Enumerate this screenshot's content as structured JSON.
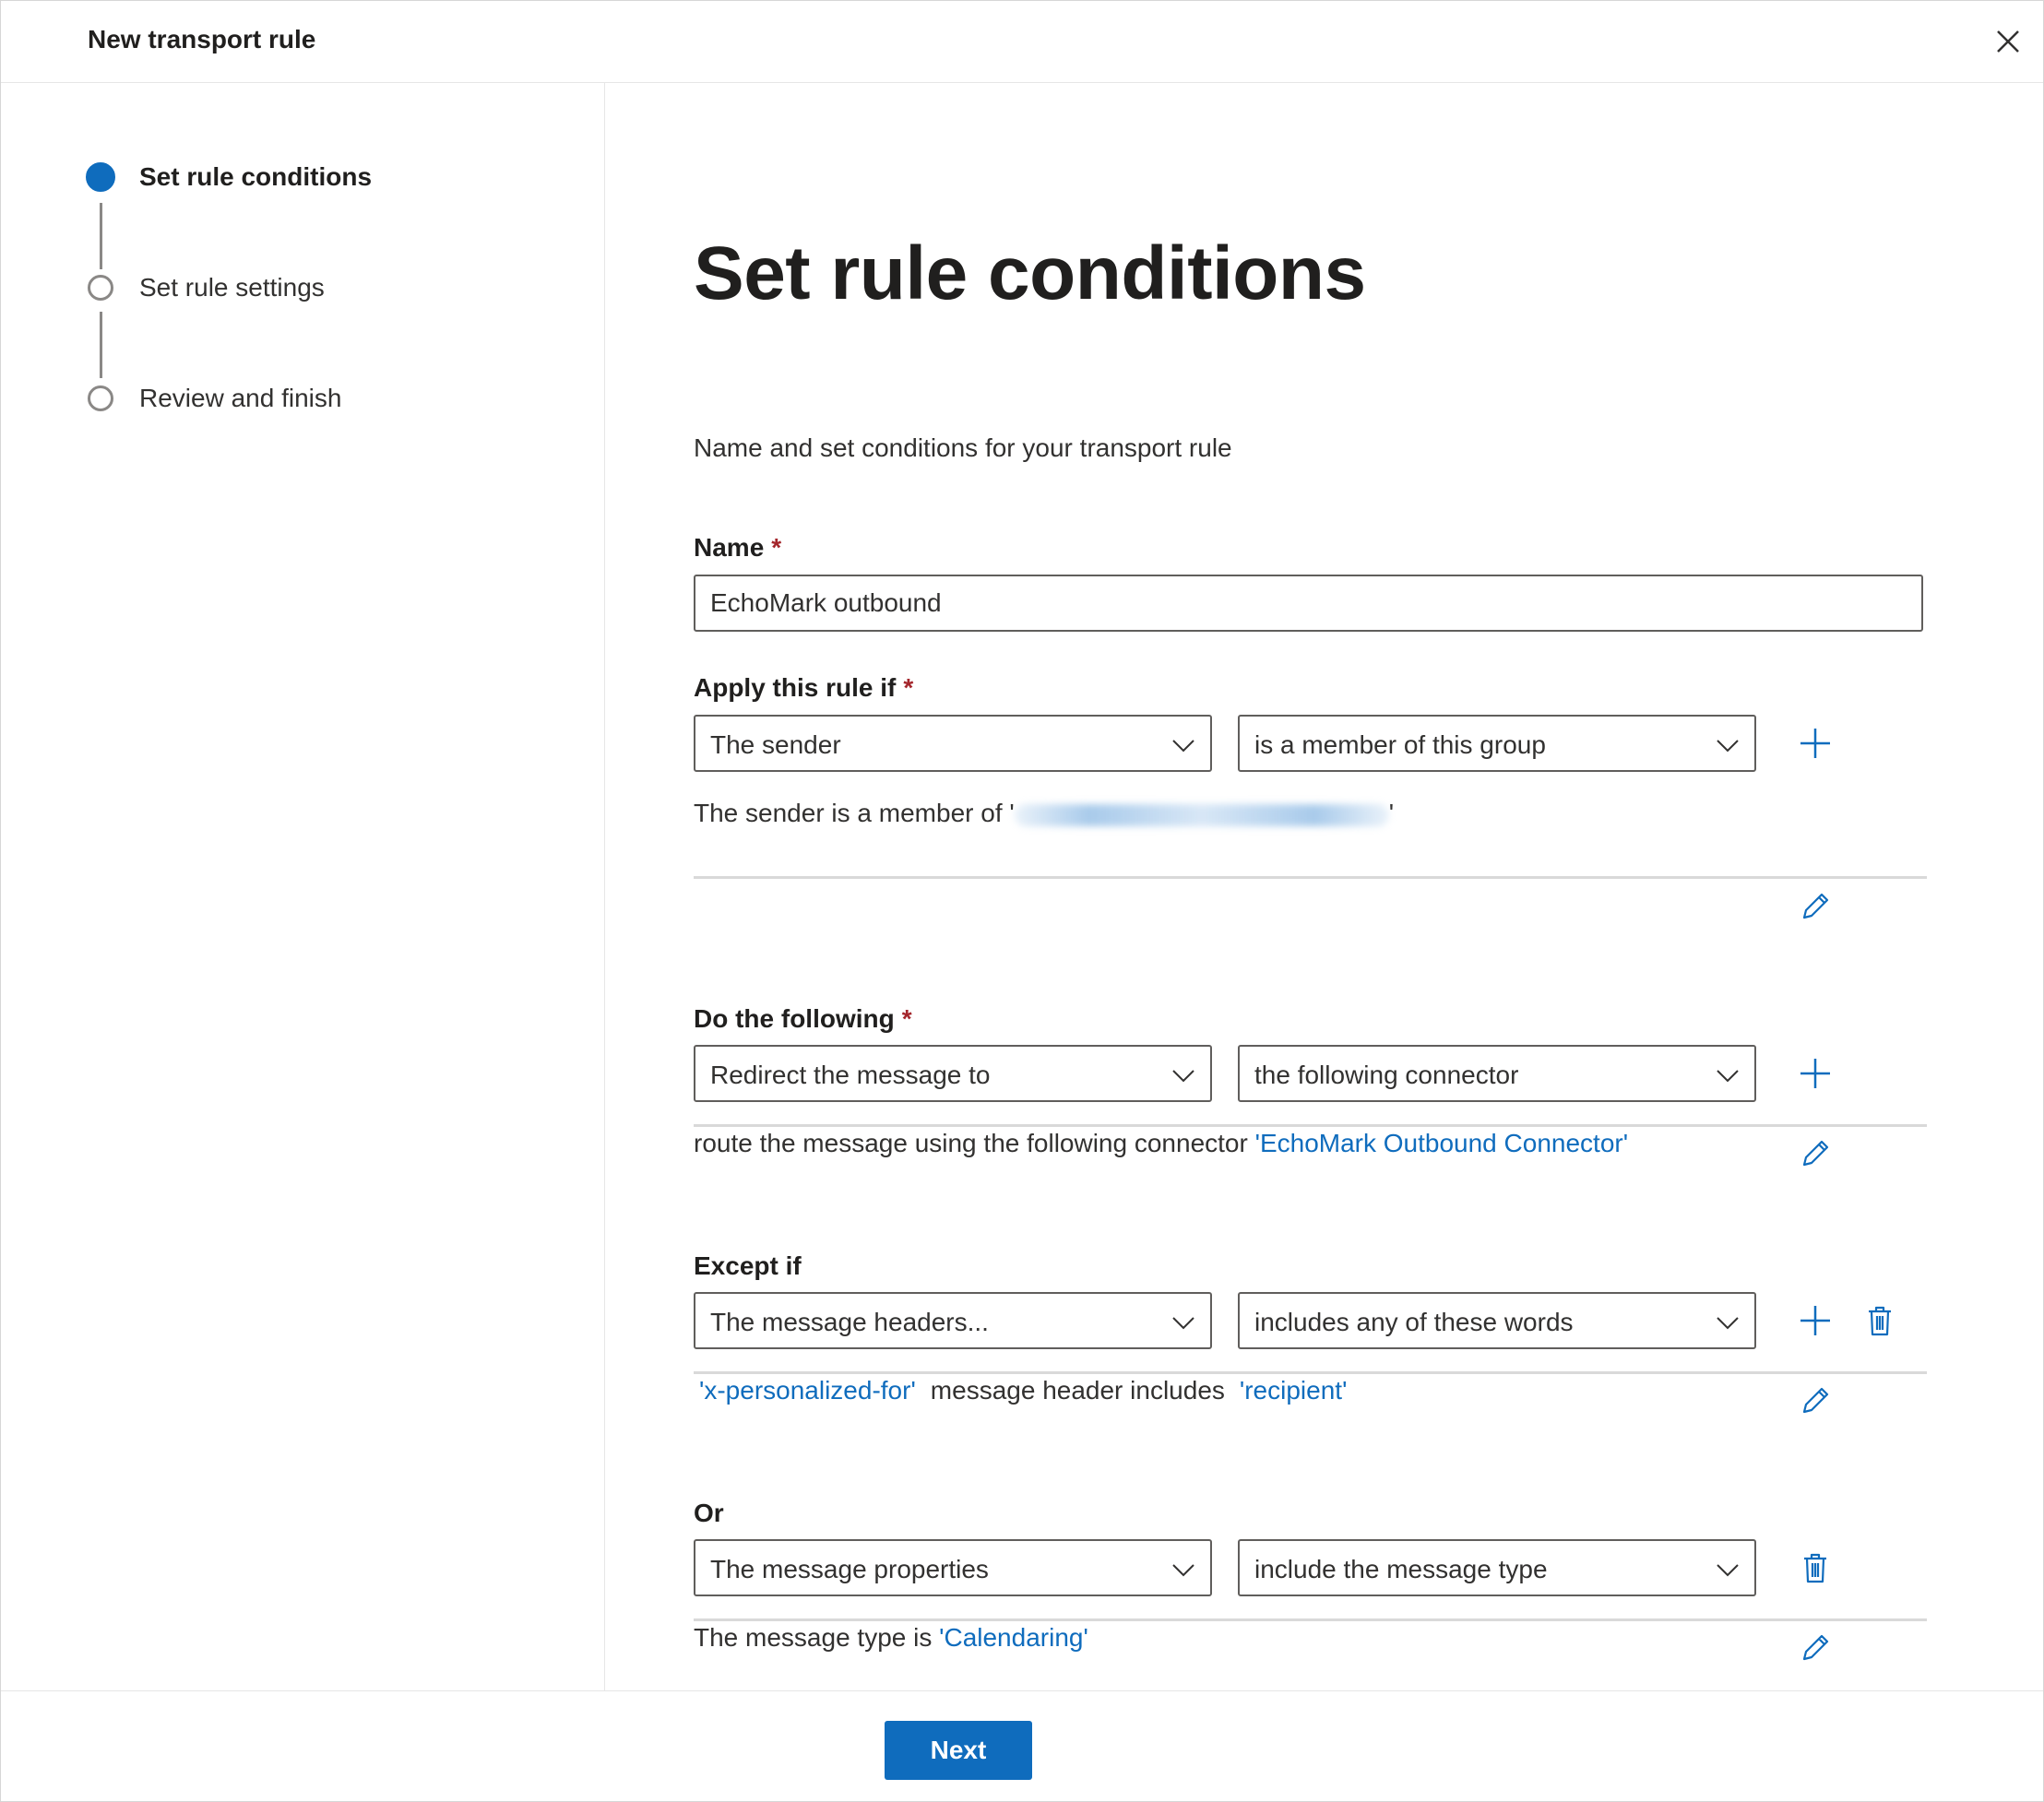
{
  "window": {
    "title": "New transport rule"
  },
  "steps": [
    {
      "label": "Set rule conditions",
      "state": "current"
    },
    {
      "label": "Set rule settings",
      "state": "pending"
    },
    {
      "label": "Review and finish",
      "state": "pending"
    }
  ],
  "main": {
    "heading": "Set rule conditions",
    "subtitle": "Name and set conditions for your transport rule",
    "name": {
      "label": "Name",
      "required_mark": "*",
      "value": "EchoMark outbound"
    },
    "apply": {
      "label": "Apply this rule if",
      "required_mark": "*",
      "select1": "The sender",
      "select2": "is a member of this group",
      "desc_prefix": "The sender is a member of '",
      "desc_suffix": "'"
    },
    "do": {
      "label": "Do the following",
      "required_mark": "*",
      "select1": "Redirect the message to",
      "select2": "the following connector",
      "desc_prefix": "route the message using the following connector ",
      "desc_link": "'EchoMark Outbound Connector'"
    },
    "except": {
      "label": "Except if",
      "select1": "The message headers...",
      "select2": "includes any of these words",
      "desc_link1": "'x-personalized-for'",
      "desc_middle": "message header includes",
      "desc_link2": "'recipient'"
    },
    "or": {
      "label": "Or",
      "select1": "The message properties",
      "select2": "include the message type",
      "desc_prefix": "The message type is ",
      "desc_link": "'Calendaring'"
    }
  },
  "footer": {
    "next_label": "Next"
  },
  "colors": {
    "accent": "#0f6cbd",
    "required": "#a4262c",
    "text": "#323130",
    "border": "#605e5c"
  },
  "icons": [
    "close-icon",
    "chevron-down-icon",
    "plus-icon",
    "pencil-icon",
    "trash-icon"
  ]
}
